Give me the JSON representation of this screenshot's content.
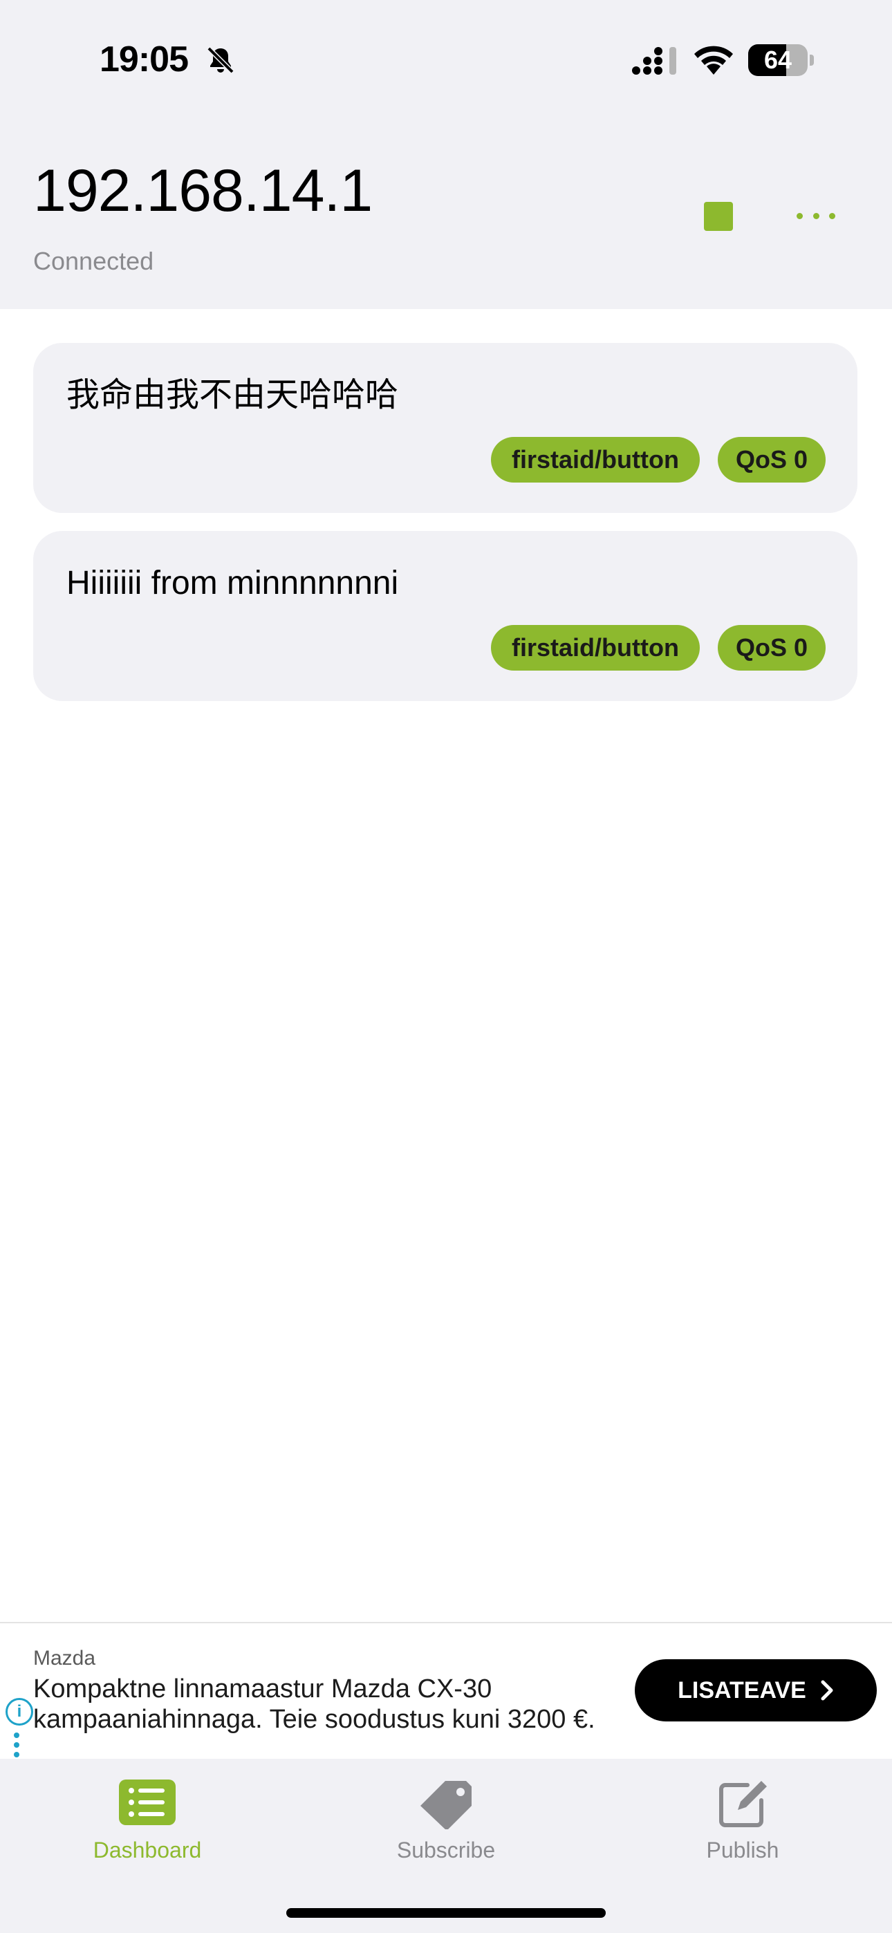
{
  "status_bar": {
    "time": "19:05",
    "battery_level": 64,
    "battery_label": "64"
  },
  "header": {
    "title": "192.168.14.1",
    "subtitle": "Connected",
    "accent_color": "#8db92e"
  },
  "messages": [
    {
      "text": "我命由我不由天哈哈哈",
      "topic": "firstaid/button",
      "qos": "QoS 0"
    },
    {
      "text": "Hiiiiiii from minnnnnnni",
      "topic": "firstaid/button",
      "qos": "QoS 0"
    }
  ],
  "ad": {
    "brand": "Mazda",
    "line1": "Kompaktne linnamaastur Mazda CX-30",
    "line2": "kampaaniahinnaga. Teie soodustus kuni 3200 €.",
    "cta": "LISATEAVE"
  },
  "tabs": [
    {
      "label": "Dashboard",
      "icon": "list-icon",
      "active": true
    },
    {
      "label": "Subscribe",
      "icon": "tag-icon",
      "active": false
    },
    {
      "label": "Publish",
      "icon": "compose-icon",
      "active": false
    }
  ]
}
